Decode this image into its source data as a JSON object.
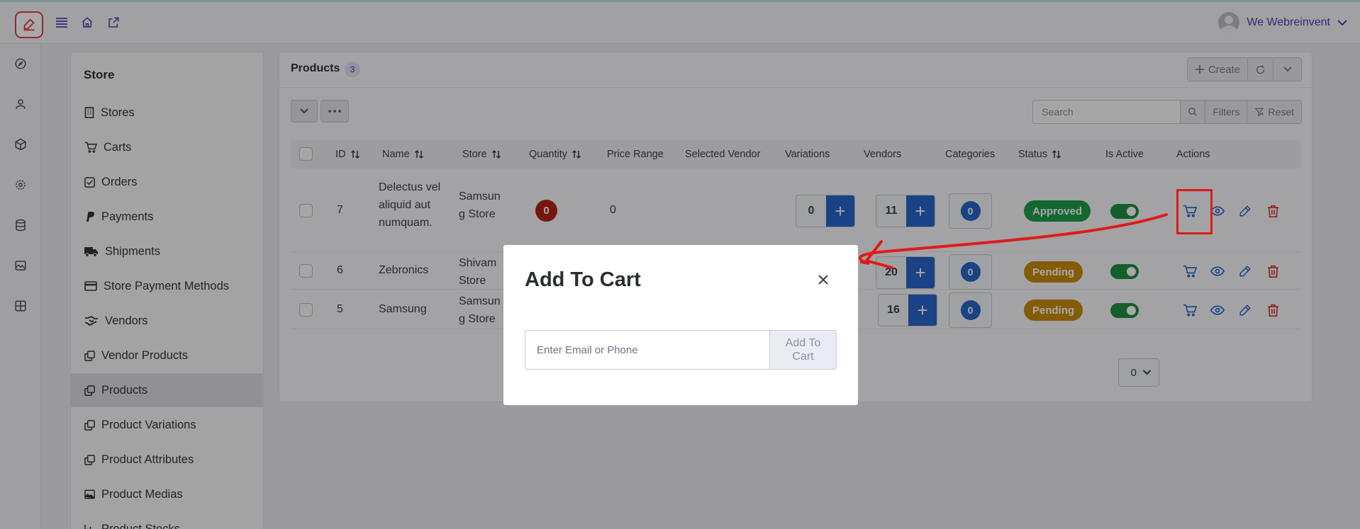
{
  "header": {
    "user_name": "We Webreinvent"
  },
  "sidebar": {
    "title": "Store",
    "items": [
      {
        "label": "Stores"
      },
      {
        "label": "Carts"
      },
      {
        "label": "Orders"
      },
      {
        "label": "Payments"
      },
      {
        "label": "Shipments"
      },
      {
        "label": "Store Payment Methods"
      },
      {
        "label": "Vendors"
      },
      {
        "label": "Vendor Products"
      },
      {
        "label": "Products"
      },
      {
        "label": "Product Variations"
      },
      {
        "label": "Product Attributes"
      },
      {
        "label": "Product Medias"
      },
      {
        "label": "Product Stocks"
      }
    ],
    "active_item": "Products"
  },
  "products": {
    "title": "Products",
    "count": "3",
    "toolbar": {
      "create_label": "Create",
      "search_placeholder": "Search",
      "filters_label": "Filters",
      "reset_label": "Reset"
    },
    "columns": [
      "ID",
      "Name",
      "Store",
      "Quantity",
      "Price Range",
      "Selected Vendor",
      "Variations",
      "Vendors",
      "Categories",
      "Status",
      "Is Active",
      "Actions"
    ],
    "rows": [
      {
        "id": "7",
        "name": "Delectus vel aliquid aut numquam.",
        "store": "Samsung Store",
        "quantity": "0",
        "price_range": "0",
        "variations": "0",
        "vendors": "11",
        "categories": "0",
        "status": "Approved",
        "is_active": true
      },
      {
        "id": "6",
        "name": "Zebronics",
        "store": "Shivam Store",
        "quantity": "",
        "price_range": "",
        "variations": "",
        "vendors": "20",
        "categories": "0",
        "status": "Pending",
        "is_active": true
      },
      {
        "id": "5",
        "name": "Samsung",
        "store": "Samsung Store",
        "quantity": "",
        "price_range": "",
        "variations": "",
        "vendors": "16",
        "categories": "0",
        "status": "Pending",
        "is_active": true
      }
    ],
    "status_colors": {
      "Approved": "#1e9e4a",
      "Pending": "#c98a0a"
    },
    "pager_value": "0"
  },
  "modal": {
    "title": "Add To Cart",
    "input_placeholder": "Enter Email or Phone",
    "submit_label": "Add To Cart"
  },
  "colors": {
    "brand": "#4a3fb8",
    "primary": "#2864c8",
    "danger": "#b42318",
    "annotation": "#e01b1b"
  }
}
